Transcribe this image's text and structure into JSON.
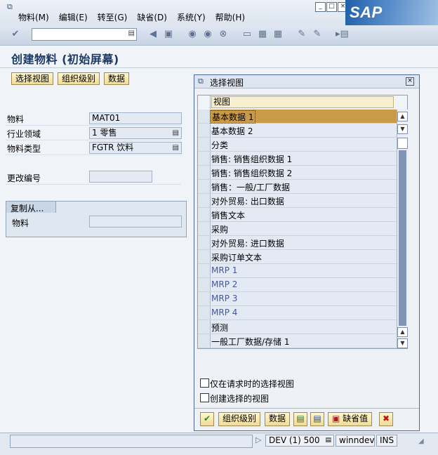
{
  "menu": {
    "items": [
      "物料(M)",
      "编辑(E)",
      "转至(G)",
      "缺省(D)",
      "系统(Y)",
      "帮助(H)"
    ]
  },
  "brand": {
    "logo": "SAP",
    "color": "#1f5fa8"
  },
  "toolbar": {
    "icons": [
      "enter-icon",
      "back-icon",
      "save-icon",
      "exit-icon",
      "cancel-icon",
      "print-icon",
      "find-icon",
      "find-next-icon",
      "first-page-icon",
      "last-page-icon",
      "new-session-icon",
      "shortcut-icon",
      "help-icon"
    ]
  },
  "page": {
    "title": "创建物料 (初始屏幕)"
  },
  "app_buttons": {
    "select_view": "选择视图",
    "org_levels": "组织级别",
    "data": "数据"
  },
  "form": {
    "material_label": "物料",
    "material_value": "MAT01",
    "industry_label": "行业领域",
    "industry_value": "1 零售",
    "mattype_label": "物料类型",
    "mattype_value": "FGTR 饮料",
    "change_no_label": "更改编号",
    "change_no_value": "",
    "copy_from_tab": "复制从...",
    "copy_material_label": "物料",
    "copy_material_value": ""
  },
  "dialog": {
    "title": "选择视图",
    "column_header": "视图",
    "rows": [
      "基本数据 1",
      "基本数据 2",
      "分类",
      "销售: 销售组织数据 1",
      "销售: 销售组织数据 2",
      "销售：一般/工厂数据",
      "对外贸易: 出口数据",
      "销售文本",
      "采购",
      "对外贸易: 进口数据",
      "采购订单文本",
      "MRP 1",
      "MRP 2",
      "MRP 3",
      "MRP 4",
      "预测",
      "一般工厂数据/存储 1"
    ],
    "selected_index": 0,
    "check_only_on_request": "仅在请求时的选择视图",
    "check_create_views": "创建选择的视图",
    "btn_org_levels": "组织级别",
    "btn_data": "数据",
    "btn_default": "缺省值"
  },
  "status": {
    "system": "DEV (1) 500",
    "server": "winndev",
    "mode": "INS"
  }
}
